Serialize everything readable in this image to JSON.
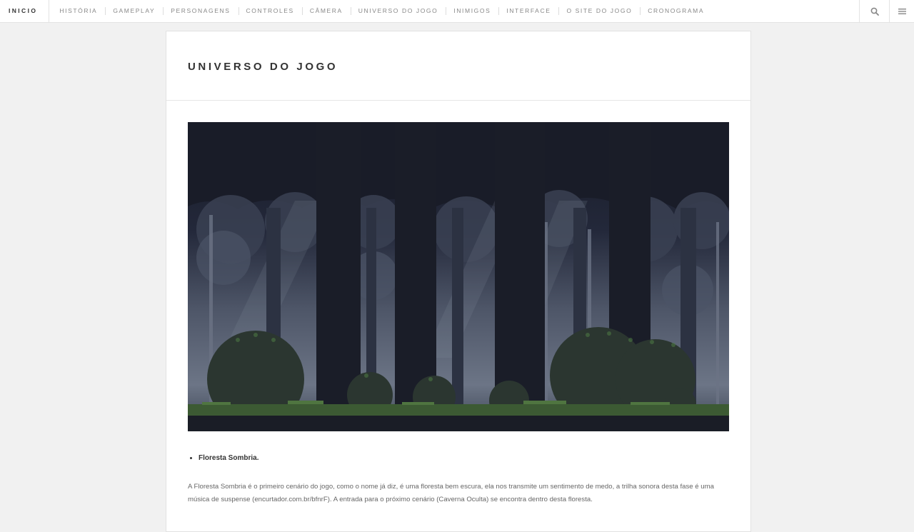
{
  "nav": {
    "home": "INICIO",
    "items": [
      "HISTÓRIA",
      "GAMEPLAY",
      "PERSONAGENS",
      "CONTROLES",
      "CÂMERA",
      "UNIVERSO DO JOGO",
      "INIMIGOS",
      "INTERFACE",
      "O SITE DO JOGO",
      "CRONOGRAMA"
    ],
    "icons": [
      "search-icon",
      "menu-icon"
    ]
  },
  "page": {
    "title": "UNIVERSO DO JOGO",
    "section_item": "Floresta Sombria.",
    "description": "A Floresta Sombria é o primeiro cenário do jogo, como o nome já diz, é uma floresta bem escura, ela nos transmite um sentimento de medo, a trilha sonora desta fase é uma música de suspense (encurtador.com.br/bfnrF). A entrada para o próximo cenário (Caverna Oculta) se encontra dentro desta floresta."
  },
  "colors": {
    "sky": "#181b26",
    "fog": "#5c6476",
    "foliage": "#2e3a33",
    "grass": "#3c5a33",
    "ground": "#1a1d26"
  }
}
